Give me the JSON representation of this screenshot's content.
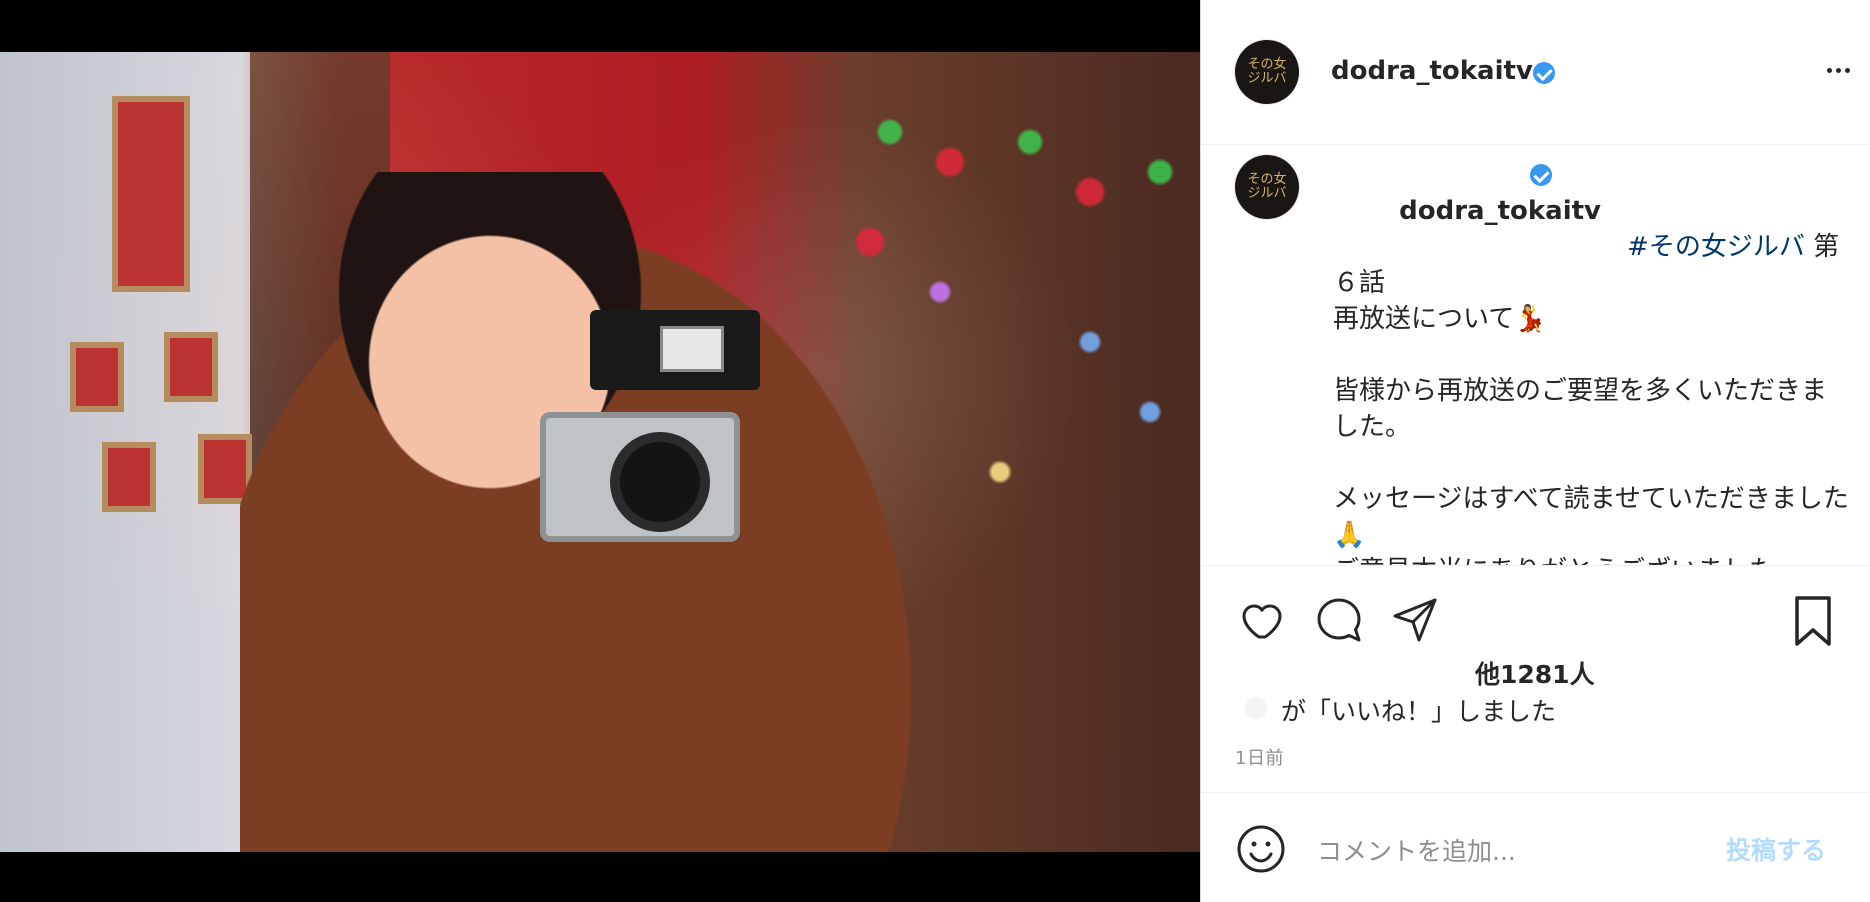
{
  "post": {
    "username": "dodra_tokaitv",
    "avatar_text": "その女\nジルバ",
    "caption": {
      "hashtag": "#その女ジルバ",
      "line1_rest": " 第６話",
      "body": "再放送について💃\n\n皆様から再放送のご要望を多くいただきました。\n\nメッセージはすべて読ませていただきました🙏\nご意見本当にありがとうございました。\n\n系列各局の皆様のご尽力もあり"
    },
    "likes_count": "他1281人",
    "likes_text": "が「いいね！」しました",
    "time": "1日前"
  },
  "comment_bar": {
    "placeholder": "コメントを追加...",
    "post_label": "投稿する"
  },
  "icons": {
    "heart": "heart-icon",
    "comment": "comment-icon",
    "share": "paper-plane-icon",
    "save": "bookmark-icon",
    "emoji": "smile-icon",
    "more": "more-dots-icon",
    "verified": "verified-badge-icon"
  },
  "colors": {
    "verified": "#3897f0",
    "hashtag": "#00376b",
    "post_button": "#b3dbff",
    "muted": "#8e8e8e",
    "text": "#262626"
  }
}
